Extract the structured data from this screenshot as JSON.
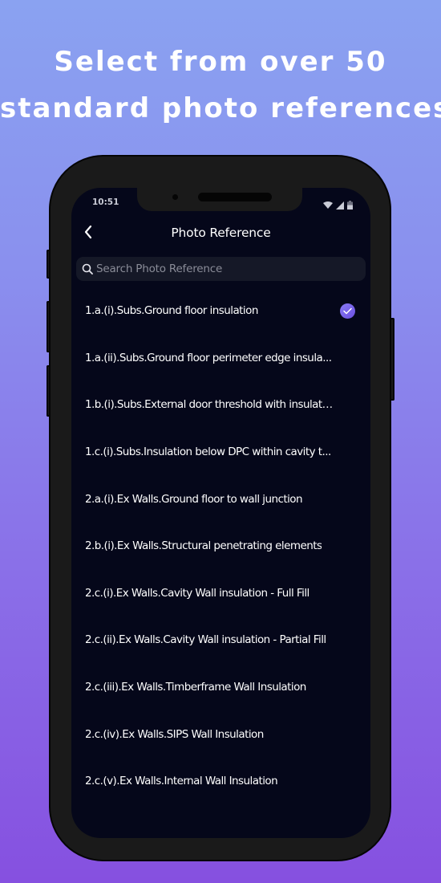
{
  "promo": {
    "line1": "Select from over 50",
    "line2": "standard photo references"
  },
  "status_bar": {
    "time": "10:51",
    "icons": [
      "wifi-icon",
      "signal-icon",
      "battery-icon"
    ]
  },
  "nav": {
    "back_icon": "chevron-left-icon",
    "title": "Photo Reference"
  },
  "search": {
    "icon": "search-icon",
    "placeholder": "Search Photo Reference",
    "value": ""
  },
  "colors": {
    "accent_check_start": "#8a7cf5",
    "accent_check_end": "#6b4fe0",
    "screen_bg": "#05071a",
    "search_bg": "#151827"
  },
  "list": {
    "items": [
      {
        "label": "1.a.(i).Subs.Ground floor insulation",
        "selected": true
      },
      {
        "label": "1.a.(ii).Subs.Ground floor perimeter edge insula...",
        "selected": false
      },
      {
        "label": "1.b.(i).Subs.External door threshold with insulati...",
        "selected": false
      },
      {
        "label": "1.c.(i).Subs.Insulation below DPC within cavity t...",
        "selected": false
      },
      {
        "label": "2.a.(i).Ex Walls.Ground floor to wall junction",
        "selected": false
      },
      {
        "label": "2.b.(i).Ex Walls.Structural penetrating elements",
        "selected": false
      },
      {
        "label": "2.c.(i).Ex Walls.Cavity Wall insulation - Full Fill",
        "selected": false
      },
      {
        "label": "2.c.(ii).Ex Walls.Cavity Wall insulation - Partial Fill",
        "selected": false
      },
      {
        "label": "2.c.(iii).Ex Walls.Timberframe Wall Insulation",
        "selected": false
      },
      {
        "label": "2.c.(iv).Ex Walls.SIPS Wall Insulation",
        "selected": false
      },
      {
        "label": "2.c.(v).Ex Walls.Internal Wall Insulation",
        "selected": false
      }
    ]
  }
}
